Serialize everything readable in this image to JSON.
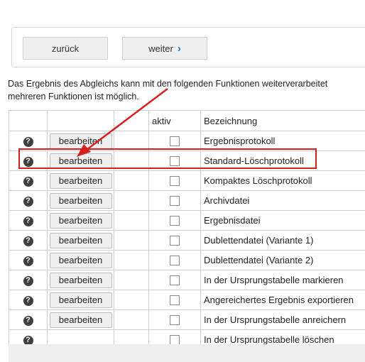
{
  "nav": {
    "back_label": "zurück",
    "next_label": "weiter",
    "next_icon": "chevron-right-icon",
    "accent_color": "#1a73c8"
  },
  "description": {
    "line1": "Das Ergebnis des Abgleichs kann mit den folgenden Funktionen weiterverarbeitet",
    "line2": "mehreren Funktionen ist möglich."
  },
  "table": {
    "headers": [
      "",
      "",
      "",
      "aktiv",
      "Bezeichnung"
    ],
    "edit_label": "bearbeiten",
    "rows": [
      {
        "name": "Ergebnisprotokoll",
        "has_edit": true,
        "active": false
      },
      {
        "name": "Standard-Löschprotokoll",
        "has_edit": true,
        "active": false
      },
      {
        "name": "Kompaktes Löschprotokoll",
        "has_edit": true,
        "active": false
      },
      {
        "name": "Archivdatei",
        "has_edit": true,
        "active": false
      },
      {
        "name": "Ergebnisdatei",
        "has_edit": true,
        "active": false
      },
      {
        "name": "Dublettendatei (Variante 1)",
        "has_edit": true,
        "active": false
      },
      {
        "name": "Dublettendatei (Variante 2)",
        "has_edit": true,
        "active": false
      },
      {
        "name": "In der Ursprungstabelle markieren",
        "has_edit": true,
        "active": false
      },
      {
        "name": "Angereichertes Ergebnis exportieren",
        "has_edit": true,
        "active": false
      },
      {
        "name": "In der Ursprungstabelle anreichern",
        "has_edit": true,
        "active": false
      },
      {
        "name": "In der Ursprungstabelle löschen",
        "has_edit": false,
        "active": false
      }
    ]
  },
  "annotation": {
    "color": "#d62020",
    "highlighted_row": "Standard-Löschprotokoll"
  }
}
